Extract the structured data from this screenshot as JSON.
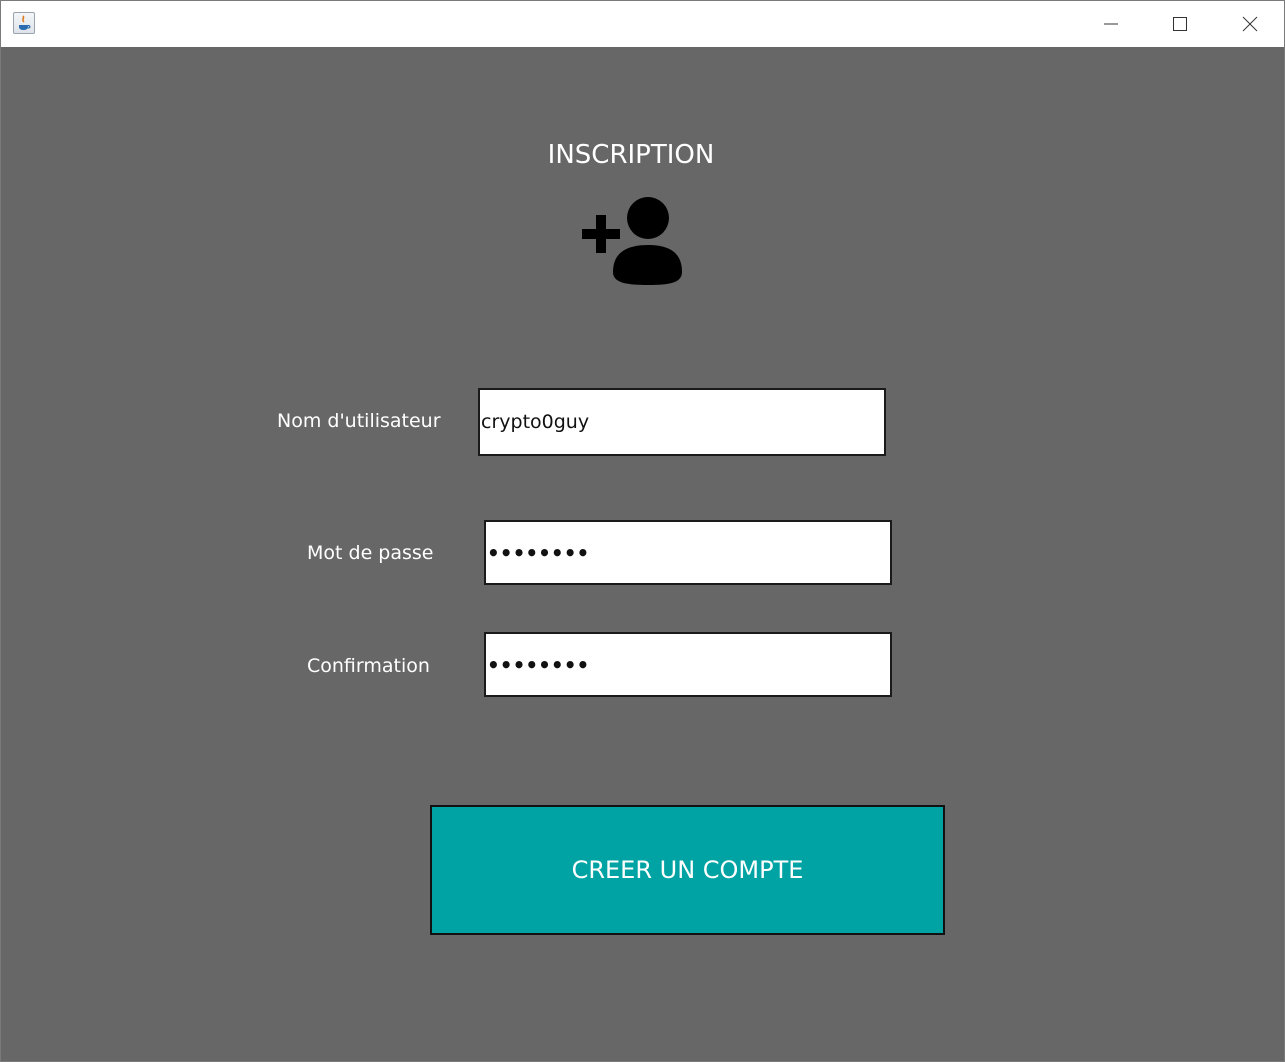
{
  "window": {
    "controls": {
      "minimize": "minimize-icon",
      "maximize": "maximize-icon",
      "close": "close-icon"
    }
  },
  "form": {
    "title": "INSCRIPTION",
    "icon": "add-user-icon",
    "username_label": "Nom d'utilisateur",
    "username_value": "crypto0guy",
    "password_label": "Mot de passe",
    "password_value": "••••••••",
    "confirm_label": "Confirmation",
    "confirm_value": "••••••••",
    "submit_label": "CREER UN COMPTE"
  },
  "colors": {
    "background": "#676767",
    "accent": "#00a3a3",
    "text": "#ffffff"
  }
}
